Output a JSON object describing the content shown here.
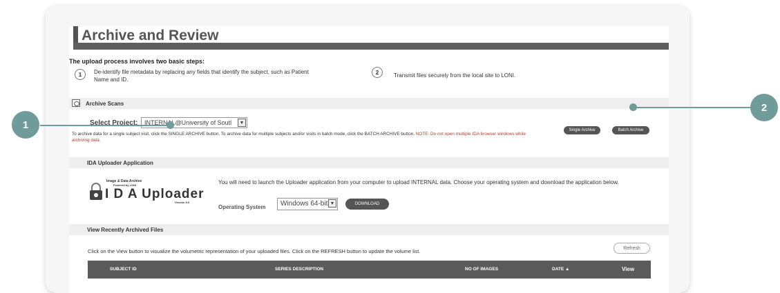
{
  "page": {
    "title": "Archive and Review",
    "intro": "The upload process involves two basic steps:",
    "steps": [
      {
        "num": "1",
        "text": "De-identify file metadata by replacing any fields that identify the subject, such as Patient Name and ID."
      },
      {
        "num": "2",
        "text": "Transmit files securely from the local site to LONI."
      }
    ]
  },
  "archive": {
    "header": "Archive Scans",
    "project_label": "Select Project:",
    "project_value": "INTERNAL@University of Soutl",
    "instructions": "To archive data for a single subject visit, click the SINGLE ARCHIVE button. To archive data for multiple subjects and/or visits in batch mode, click the BATCH ARCHIVE button.",
    "note": "NOTE: Do not open multiple IDA browser windows while archiving data.",
    "single_btn": "Single Archive",
    "batch_btn": "Batch Archive"
  },
  "uploader": {
    "header": "IDA Uploader Application",
    "logo_top": "Image & Data Archive",
    "logo_sub": "Powered by LONI",
    "logo_main": "I D A Uploader",
    "logo_version": "Version 8.0",
    "description": "You will need to launch the Uploader application from your computer to upload INTERNAL data. Choose your operating system and download the application below.",
    "os_label": "Operating System",
    "os_value": "Windows 64-bit",
    "download_btn": "DOWNLOAD"
  },
  "recent": {
    "header": "View Recently Archived Files",
    "instructions": "Click on the View button to visualize the volumetric representation of your uploaded files. Click on the REFRESH button to update the volume list.",
    "refresh_btn": "Refresh",
    "columns": [
      "SUBJECT ID",
      "SERIES DESCRIPTION",
      "NO OF IMAGES",
      "DATE ▲",
      "View"
    ]
  },
  "markers": {
    "one": "1",
    "two": "2"
  },
  "colors": {
    "accent": "#6f9b9b",
    "note_red": "#c0392b",
    "table_header": "#5a5a5a"
  }
}
